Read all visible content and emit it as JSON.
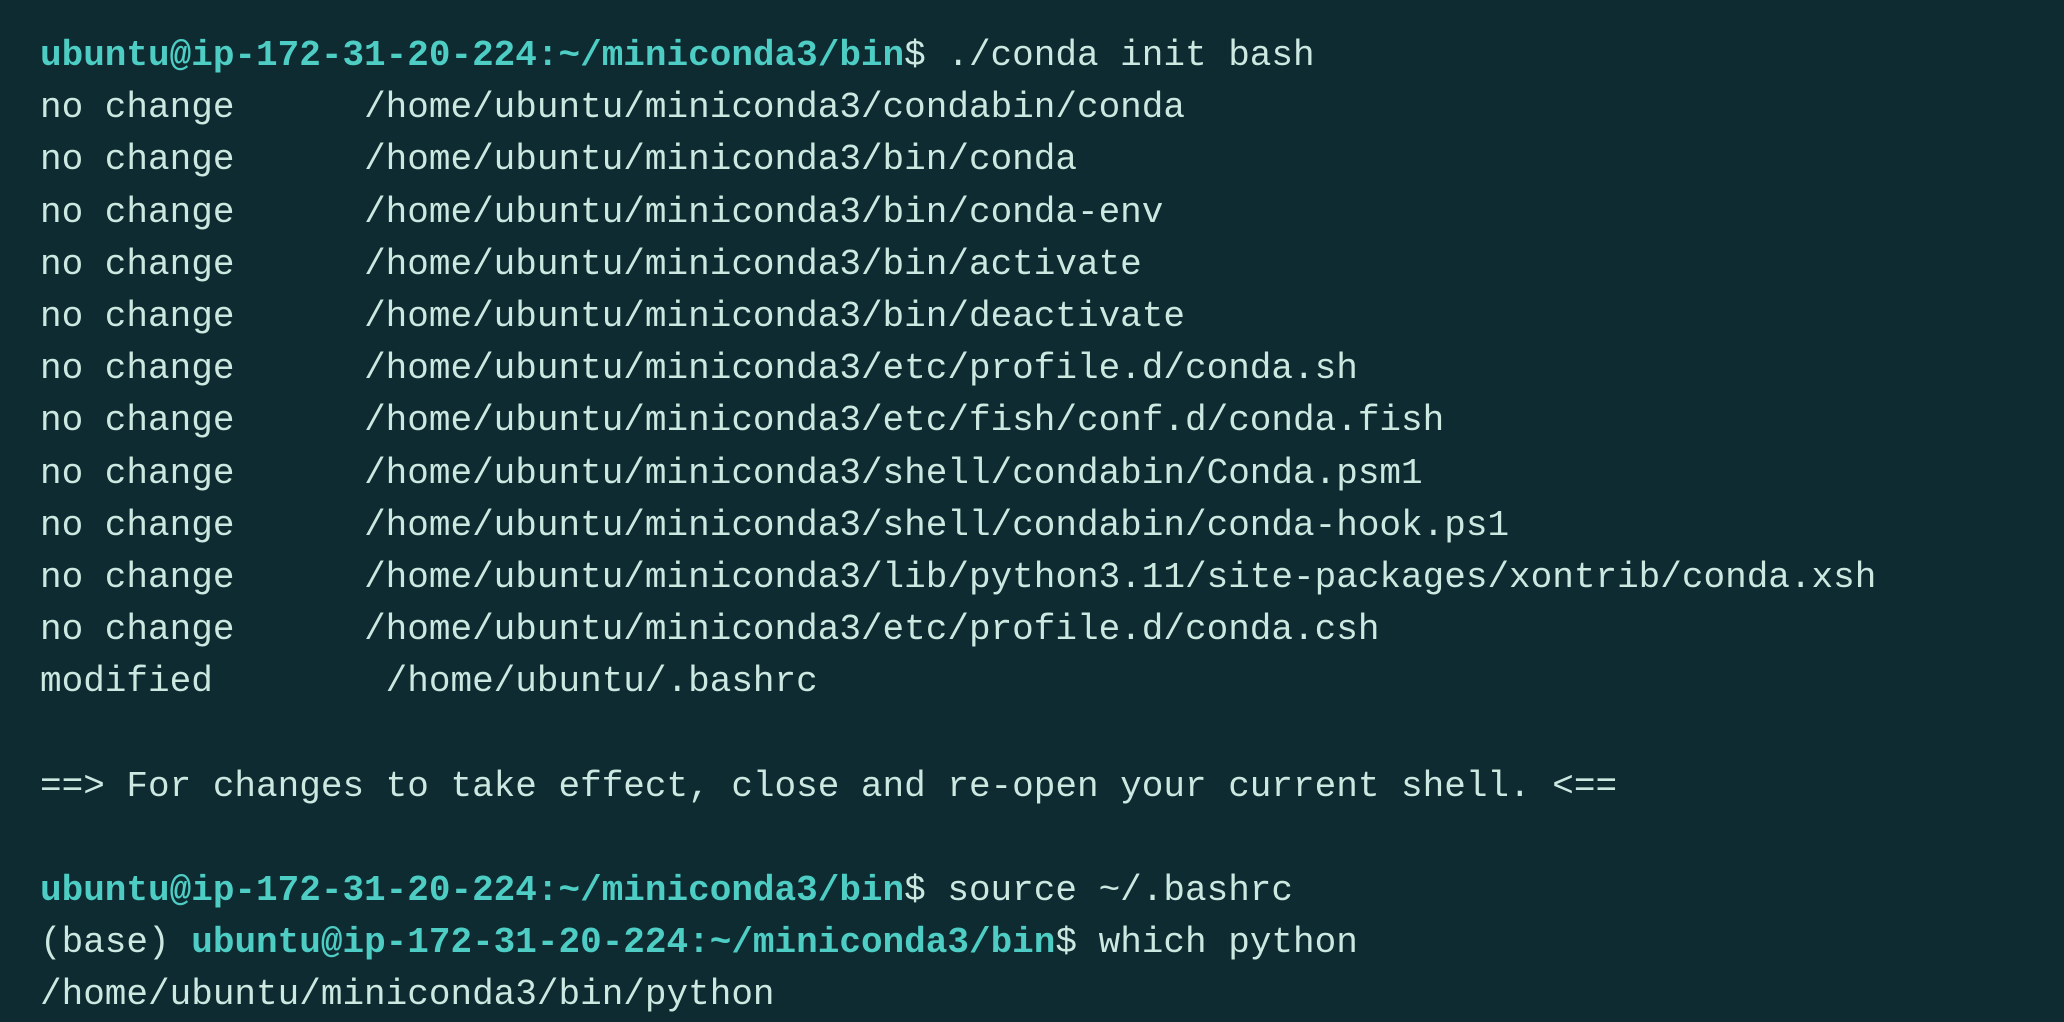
{
  "terminal": {
    "prompt1": "ubuntu@ip-172-31-20-224:~/miniconda3/bin",
    "dollar": "$",
    "cmd1": " ./conda init bash",
    "lines": [
      {
        "label": "no change",
        "padding": "      ",
        "path": "/home/ubuntu/miniconda3/condabin/conda"
      },
      {
        "label": "no change",
        "padding": "      ",
        "path": "/home/ubuntu/miniconda3/bin/conda"
      },
      {
        "label": "no change",
        "padding": "      ",
        "path": "/home/ubuntu/miniconda3/bin/conda-env"
      },
      {
        "label": "no change",
        "padding": "      ",
        "path": "/home/ubuntu/miniconda3/bin/activate"
      },
      {
        "label": "no change",
        "padding": "      ",
        "path": "/home/ubuntu/miniconda3/bin/deactivate"
      },
      {
        "label": "no change",
        "padding": "      ",
        "path": "/home/ubuntu/miniconda3/etc/profile.d/conda.sh"
      },
      {
        "label": "no change",
        "padding": "      ",
        "path": "/home/ubuntu/miniconda3/etc/fish/conf.d/conda.fish"
      },
      {
        "label": "no change",
        "padding": "      ",
        "path": "/home/ubuntu/miniconda3/shell/condabin/Conda.psm1"
      },
      {
        "label": "no change",
        "padding": "      ",
        "path": "/home/ubuntu/miniconda3/shell/condabin/conda-hook.ps1"
      },
      {
        "label": "no change",
        "padding": "      ",
        "path": "/home/ubuntu/miniconda3/lib/python3.11/site-packages/xontrib/conda.xsh"
      },
      {
        "label": "no change",
        "padding": "      ",
        "path": "/home/ubuntu/miniconda3/etc/profile.d/conda.csh"
      },
      {
        "label": "modified",
        "padding": "        ",
        "path": "/home/ubuntu/.bashrc"
      }
    ],
    "message": "==> For changes to take effect, close and re-open your current shell. <==",
    "prompt2": "ubuntu@ip-172-31-20-224:~/miniconda3/bin",
    "cmd2": " source ~/.bashrc",
    "base_prefix": "(base) ",
    "prompt3": "ubuntu@ip-172-31-20-224:~/miniconda3/bin",
    "cmd3": " which python",
    "python_path": "/home/ubuntu/miniconda3/bin/python"
  }
}
